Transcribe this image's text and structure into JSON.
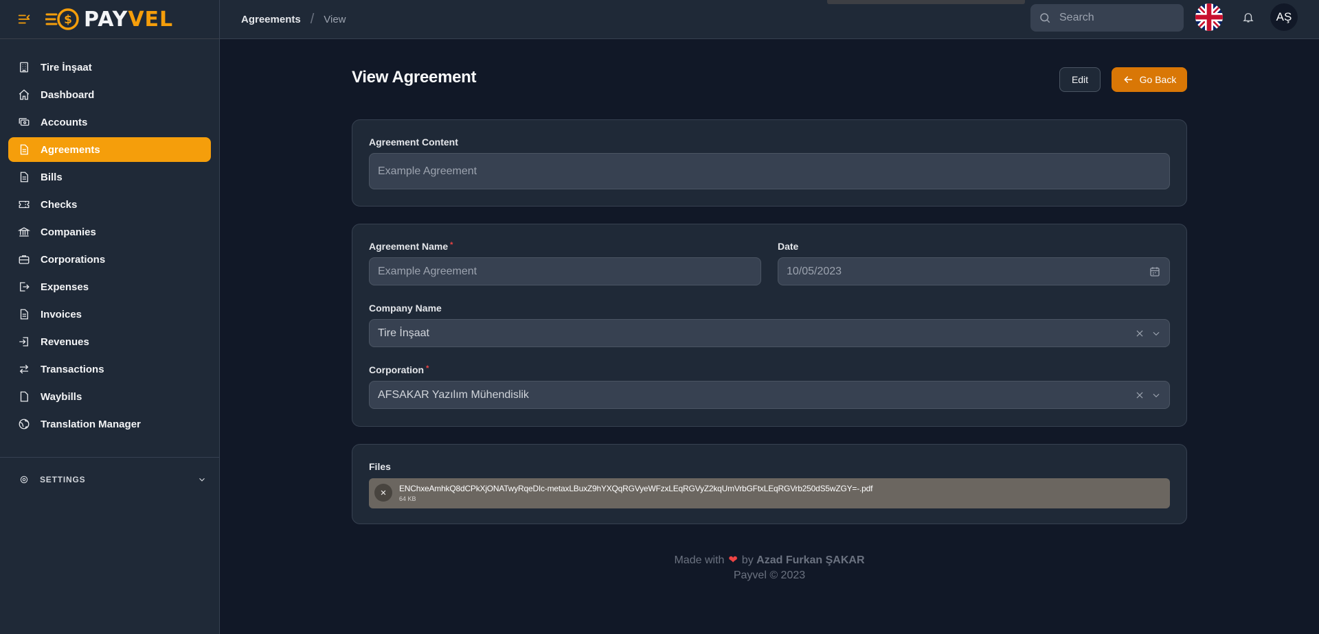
{
  "brand": {
    "logo_left": "PAY",
    "logo_right": "VEL"
  },
  "sidebar": {
    "items": [
      {
        "label": "Tire İnşaat",
        "icon": "building-icon",
        "active": false
      },
      {
        "label": "Dashboard",
        "icon": "home-icon",
        "active": false
      },
      {
        "label": "Accounts",
        "icon": "cash-icon",
        "active": false
      },
      {
        "label": "Agreements",
        "icon": "document-icon",
        "active": true
      },
      {
        "label": "Bills",
        "icon": "document-icon",
        "active": false
      },
      {
        "label": "Checks",
        "icon": "ticket-icon",
        "active": false
      },
      {
        "label": "Companies",
        "icon": "library-icon",
        "active": false
      },
      {
        "label": "Corporations",
        "icon": "briefcase-icon",
        "active": false
      },
      {
        "label": "Expenses",
        "icon": "logout-icon",
        "active": false
      },
      {
        "label": "Invoices",
        "icon": "document-icon",
        "active": false
      },
      {
        "label": "Revenues",
        "icon": "login-icon",
        "active": false
      },
      {
        "label": "Transactions",
        "icon": "switch-icon",
        "active": false
      },
      {
        "label": "Waybills",
        "icon": "file-icon",
        "active": false
      },
      {
        "label": "Translation Manager",
        "icon": "globe-icon",
        "active": false
      }
    ],
    "settings_label": "SETTINGS"
  },
  "topbar": {
    "breadcrumb": [
      "Agreements",
      "View"
    ],
    "search_placeholder": "Search",
    "avatar_initials": "AŞ"
  },
  "page": {
    "title": "View Agreement",
    "edit_label": "Edit",
    "back_label": "Go Back"
  },
  "form": {
    "content_label": "Agreement Content",
    "content_value": "Example Agreement",
    "name_label": "Agreement Name",
    "name_value": "Example Agreement",
    "date_label": "Date",
    "date_value": "10/05/2023",
    "company_label": "Company Name",
    "company_value": "Tire İnşaat",
    "corporation_label": "Corporation",
    "corporation_value": "AFSAKAR Yazılım Mühendislik",
    "required_mark": "*"
  },
  "files": {
    "label": "Files",
    "items": [
      {
        "name": "ENChxeAmhkQ8dCPkXjONATwyRqeDIc-metaxLBuxZ9hYXQqRGVyeWFzxLEqRGVyZ2kqUmVrbGFtxLEqRGVrb250dS5wZGY=-.pdf",
        "size": "64 KB"
      }
    ]
  },
  "footer": {
    "made_with": "Made with",
    "by": "by",
    "author": "Azad Furkan ŞAKAR",
    "copyright": "Payvel © 2023"
  },
  "colors": {
    "accent": "#f59e0b",
    "accent_dark": "#d97706",
    "bg": "#111827",
    "panel": "#1f2937",
    "field": "#374151"
  }
}
